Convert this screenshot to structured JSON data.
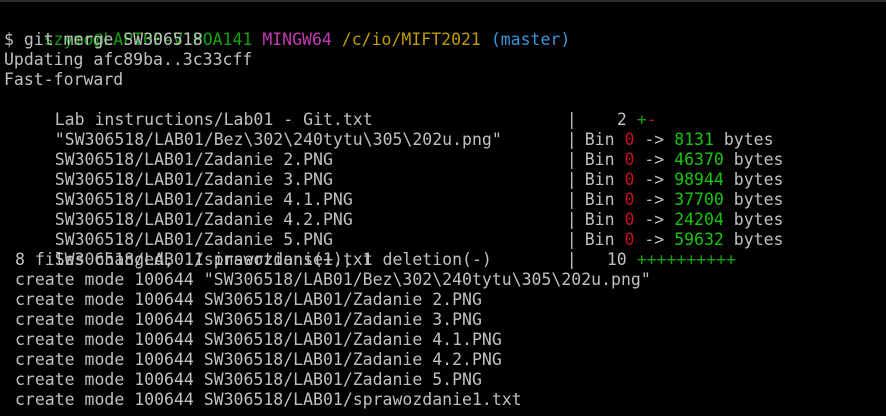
{
  "prompt": {
    "user_host": "szymo@LAPTOP-V1POA141",
    "space1": " ",
    "shell": "MINGW64",
    "space2": " ",
    "path": "/c/io/MIFT2021",
    "space3": " ",
    "branch": "(master)"
  },
  "command": "$ git merge SW306518",
  "output": {
    "updating": "Updating afc89ba..3c33cff",
    "fast_forward": "Fast-forward",
    "summary": "8 files changed, 11 insertions(+), 1 deletion(-)"
  },
  "pipe": "| ",
  "arrow": " -> ",
  "diffstat": [
    {
      "file": "Lab instructions/Lab01 - Git.txt",
      "count": "2",
      "plus": "+",
      "minus": "-"
    },
    {
      "file": "\"SW306518/LAB01/Bez\\302\\240tytu\\305\\202u.png\"",
      "kind": "Bin",
      "from": "0",
      "to": "8131",
      "unit": " bytes"
    },
    {
      "file": "SW306518/LAB01/Zadanie 2.PNG",
      "kind": "Bin",
      "from": "0",
      "to": "46370",
      "unit": " bytes"
    },
    {
      "file": "SW306518/LAB01/Zadanie 3.PNG",
      "kind": "Bin",
      "from": "0",
      "to": "98944",
      "unit": " bytes"
    },
    {
      "file": "SW306518/LAB01/Zadanie 4.1.PNG",
      "kind": "Bin",
      "from": "0",
      "to": "37700",
      "unit": " bytes"
    },
    {
      "file": "SW306518/LAB01/Zadanie 4.2.PNG",
      "kind": "Bin",
      "from": "0",
      "to": "24204",
      "unit": " bytes"
    },
    {
      "file": "SW306518/LAB01/Zadanie 5.PNG",
      "kind": "Bin",
      "from": "0",
      "to": "59632",
      "unit": " bytes"
    },
    {
      "file": "SW306518/LAB01/sprawozdanie1.txt",
      "count": "10",
      "plus": "++++++++++",
      "minus": ""
    }
  ],
  "create_lines": [
    "create mode 100644 \"SW306518/LAB01/Bez\\302\\240tytu\\305\\202u.png\"",
    "create mode 100644 SW306518/LAB01/Zadanie 2.PNG",
    "create mode 100644 SW306518/LAB01/Zadanie 3.PNG",
    "create mode 100644 SW306518/LAB01/Zadanie 4.1.PNG",
    "create mode 100644 SW306518/LAB01/Zadanie 4.2.PNG",
    "create mode 100644 SW306518/LAB01/Zadanie 5.PNG",
    "create mode 100644 SW306518/LAB01/sprawozdanie1.txt"
  ],
  "colors": {
    "background": "#000000",
    "text": "#c0c0c0",
    "prompt_user": "#13a10e",
    "prompt_shell": "#c239b3",
    "prompt_path": "#c19c00",
    "prompt_branch": "#3a96dd",
    "added": "#16c60c",
    "removed": "#c50f1f"
  }
}
